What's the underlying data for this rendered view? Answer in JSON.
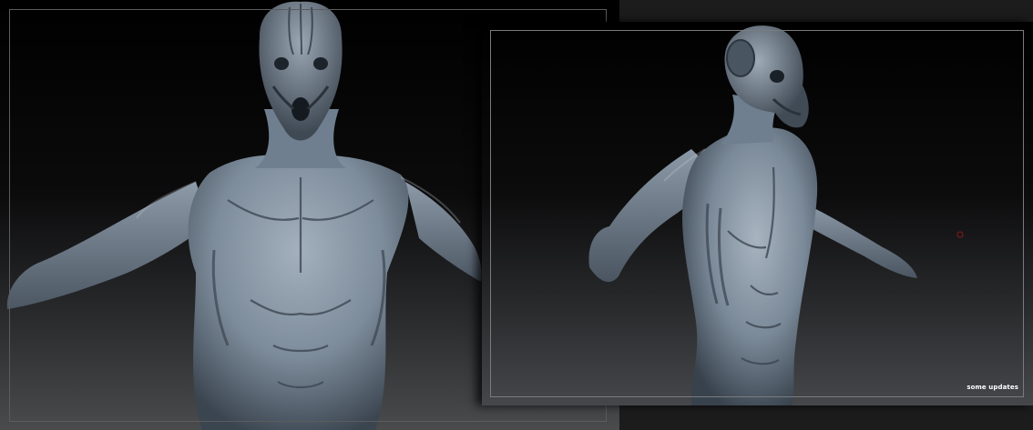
{
  "caption": "some updates",
  "render": {
    "skin_base": "#6f7f8f",
    "skin_light": "#a3b0bd",
    "skin_shadow": "#2e3640",
    "frame_color": "#5b5c5e",
    "cursor_color": "#8a1a1a"
  },
  "views": [
    "front-view",
    "three-quarter-view"
  ]
}
